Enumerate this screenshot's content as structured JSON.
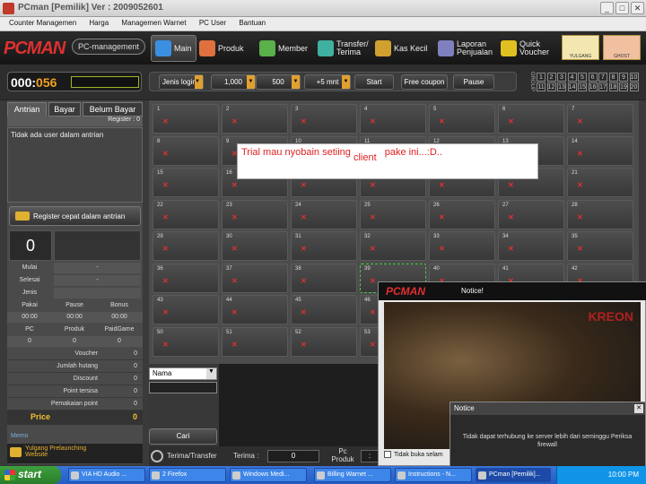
{
  "window": {
    "title": "PCman [Pemilik]  Ver : 2009052601",
    "min": "_",
    "max": "□",
    "close": "✕"
  },
  "menu": [
    "Counter Managemen",
    "Harga",
    "Managemen Warnet",
    "PC User",
    "Bantuan"
  ],
  "toolbar": {
    "logo": "PCMAN",
    "pc_management": "PC-management",
    "buttons": [
      {
        "label": "Main",
        "icon": "monitor-icon",
        "color": "#3b8fe0"
      },
      {
        "label": "Produk",
        "icon": "product-icon",
        "color": "#e07040"
      },
      {
        "label": "Member",
        "icon": "member-icon",
        "color": "#5ab04a"
      },
      {
        "label": "Transfer/\nTerima",
        "icon": "transfer-icon",
        "color": "#40b0a0"
      },
      {
        "label": "Kas Kecil",
        "icon": "cash-icon",
        "color": "#d0a030"
      },
      {
        "label": "Laporan\nPenjualan",
        "icon": "report-icon",
        "color": "#8080c0"
      },
      {
        "label": "Quick\nVoucher",
        "icon": "voucher-icon",
        "color": "#e0c020"
      }
    ],
    "game_buttons": [
      "YULGANG",
      "GHOST"
    ]
  },
  "controls": {
    "counter_prefix": "000:",
    "counter_value": "056",
    "jenis_login": "Jenis login",
    "amount": "1,000",
    "amount2": "500",
    "plus": "+5 mnt",
    "start": "Start",
    "free_coupon": "Free coupon",
    "pause": "Pause",
    "group_label": "GROUP",
    "groups": [
      "1",
      "2",
      "3",
      "4",
      "5",
      "6",
      "7",
      "8",
      "9",
      "10",
      "11",
      "12",
      "13",
      "14",
      "15",
      "16",
      "17",
      "18",
      "19",
      "20"
    ]
  },
  "left": {
    "tabs": [
      "Antrian",
      "Bayar",
      "Belum Bayar"
    ],
    "register_count": "Register : 0",
    "empty_queue": "Tidak ada user dalam antrian",
    "register_button": "Register cepat dalam antrian",
    "big_counter": "0",
    "mulai": "Mulai",
    "mulai_val": "-",
    "selesai": "Selesai",
    "selesai_val": "-",
    "jenis": "Jenis",
    "heads1": [
      "Pakai",
      "Pause",
      "Bonus"
    ],
    "vals1": [
      "00:00",
      "00:00",
      "00:00"
    ],
    "heads2": [
      "PC",
      "Produk",
      "PaidGame"
    ],
    "vals2": [
      "0",
      "0",
      "0"
    ],
    "stats": [
      {
        "label": "Voucher",
        "value": "0"
      },
      {
        "label": "Jumlah hutang",
        "value": "0"
      },
      {
        "label": "Discount",
        "value": "0"
      },
      {
        "label": "Point tersisa",
        "value": "0"
      },
      {
        "label": "Pemakaian point",
        "value": "0"
      }
    ],
    "price_label": "Price",
    "price_value": "0",
    "memo": "Memo",
    "ticker_line1": "Yulgang Prelaunching",
    "ticker_line2": "Website"
  },
  "pcs": [
    "1",
    "2",
    "3",
    "4",
    "5",
    "6",
    "7",
    "8",
    "9",
    "10",
    "11",
    "12",
    "13",
    "14",
    "15",
    "16",
    "17",
    "18",
    "19",
    "20",
    "21",
    "22",
    "23",
    "24",
    "25",
    "26",
    "27",
    "28",
    "29",
    "30",
    "31",
    "32",
    "33",
    "34",
    "35",
    "36",
    "37",
    "38",
    "39",
    "40",
    "41",
    "42",
    "43",
    "44",
    "45",
    "46",
    "47",
    "48",
    "49",
    "50",
    "51",
    "52",
    "53"
  ],
  "pc_offline_mark": "✕",
  "trial": {
    "line": "Trial mau nyobain setiing",
    "client": "client",
    "rest": "pake ini...:D.."
  },
  "bottom": {
    "nama": "Nama",
    "cari": "Cari",
    "transfer": "Terima/Transfer",
    "terima": "Terima :",
    "terima_val": "0",
    "pc_produk": "Pc Produk",
    "pc_produk_val": ":"
  },
  "promo": {
    "logo": "PCMAN",
    "title": "Notice!",
    "brand": "KREON",
    "checkbox": "Tidak buka selam"
  },
  "notice": {
    "title": "Notice",
    "close": "✕",
    "message": "Tidak dapat terhubung ke server lebih dari seminggu Periksa firewall"
  },
  "taskbar": {
    "start": "start",
    "tasks": [
      "VIA HD Audio ...",
      "2 Firefox",
      "Windows Medi...",
      "Billing Warnet ...",
      "Instructions - N...",
      "PCman [Pemilik]..."
    ],
    "clock": "10:00 PM"
  }
}
